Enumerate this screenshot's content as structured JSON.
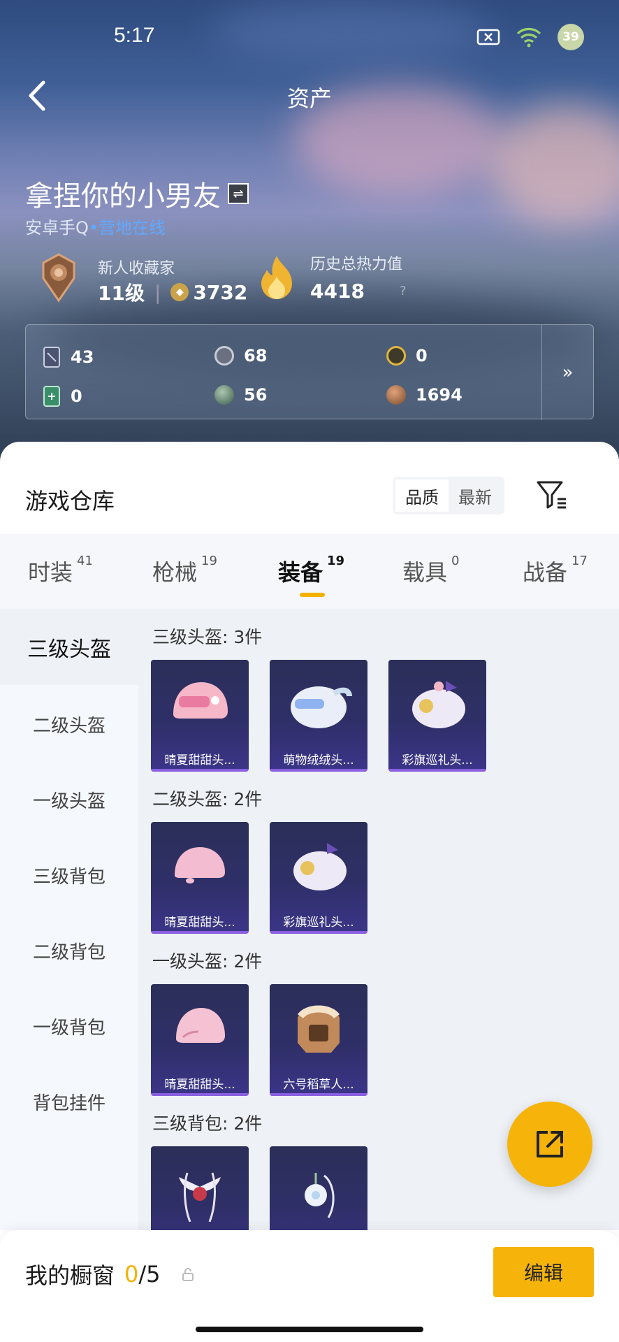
{
  "status_bar": {
    "time": "5:17",
    "battery": "39"
  },
  "header": {
    "title": "资产"
  },
  "profile": {
    "name": "拿捏你的小男友",
    "platform": "安卓手Q",
    "status": "营地在线",
    "collector_title": "新人收藏家",
    "level": "11级",
    "points": "3732",
    "heat_title": "历史总热力值",
    "heat_value": "4418",
    "heat_help": "?"
  },
  "resources": [
    "43",
    "68",
    "0",
    "0",
    "56",
    "1694"
  ],
  "warehouse": {
    "title": "游戏仓库",
    "sort_options": [
      "品质",
      "最新"
    ],
    "tabs": [
      {
        "label": "时装",
        "count": "41"
      },
      {
        "label": "枪械",
        "count": "19"
      },
      {
        "label": "装备",
        "count": "19"
      },
      {
        "label": "载具",
        "count": "0"
      },
      {
        "label": "战备",
        "count": "17"
      }
    ],
    "categories": [
      "三级头盔",
      "二级头盔",
      "一级头盔",
      "三级背包",
      "二级背包",
      "一级背包",
      "背包挂件"
    ],
    "sections": [
      {
        "title": "三级头盔: 3件",
        "items": [
          "晴夏甜甜头...",
          "萌物绒绒头...",
          "彩旗巡礼头..."
        ]
      },
      {
        "title": "二级头盔: 2件",
        "items": [
          "晴夏甜甜头...",
          "彩旗巡礼头..."
        ]
      },
      {
        "title": "一级头盔: 2件",
        "items": [
          "晴夏甜甜头...",
          "六号稻草人..."
        ]
      },
      {
        "title": "三级背包: 2件",
        "items": [
          "",
          ""
        ]
      }
    ]
  },
  "showcase": {
    "label": "我的橱窗",
    "used": "0",
    "total": "/5",
    "edit_label": "编辑"
  },
  "colors": {
    "accent": "#f6b30a",
    "online": "#5fa9ff",
    "card_bg": "#2f2f68"
  }
}
